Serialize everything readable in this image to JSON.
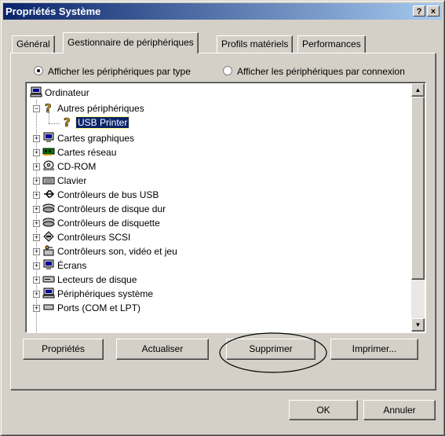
{
  "window": {
    "title": "Propriétés Système",
    "help_btn": "?",
    "close_btn": "×"
  },
  "tabs": [
    {
      "label": "Général",
      "active": false
    },
    {
      "label": "Gestionnaire de périphériques",
      "active": true
    },
    {
      "label": "Profils matériels",
      "active": false
    },
    {
      "label": "Performances",
      "active": false
    }
  ],
  "view": {
    "by_type": "Afficher les périphériques par type",
    "by_connection": "Afficher les périphériques par connexion",
    "selected": "by_type"
  },
  "tree": {
    "root": "Ordinateur",
    "other_devices": "Autres périphériques",
    "selected_child": "USB Printer",
    "categories": [
      "Cartes graphiques",
      "Cartes réseau",
      "CD-ROM",
      "Clavier",
      "Contrôleurs de bus USB",
      "Contrôleurs de disque dur",
      "Contrôleurs de disquette",
      "Contrôleurs SCSI",
      "Contrôleurs son, vidéo et jeu",
      "Écrans",
      "Lecteurs de disque",
      "Périphériques système",
      "Ports (COM et LPT)"
    ]
  },
  "buttons": {
    "properties": "Propriétés",
    "refresh": "Actualiser",
    "remove": "Supprimer",
    "print": "Imprimer...",
    "ok": "OK",
    "cancel": "Annuler"
  },
  "colors": {
    "face": "#d4d0c8",
    "title_start": "#0a246a",
    "title_end": "#a6caf0",
    "selection": "#0a246a"
  },
  "annotation": {
    "highlight_ellipse_around": "remove-button"
  }
}
